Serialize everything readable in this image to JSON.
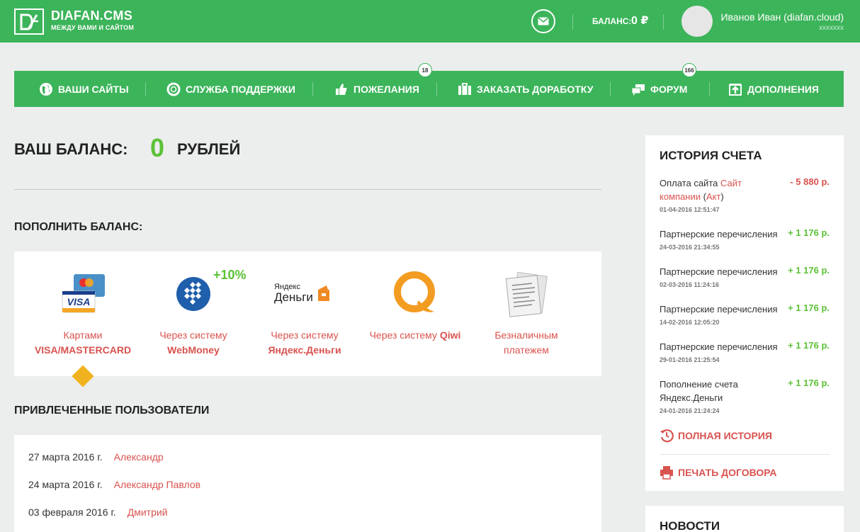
{
  "header": {
    "logo_title": "DIAFAN.CMS",
    "logo_subtitle": "МЕЖДУ ВАМИ И САЙТОМ",
    "balance_label": "БАЛАНС:",
    "balance_value": "0 ₽",
    "user_name": "Иванов Иван (diafan.cloud)",
    "user_login": "xxxxxxx",
    "icons": {
      "logo": "logo-icon",
      "mail": "mail-icon"
    }
  },
  "nav": {
    "items": [
      {
        "label": "ВАШИ САЙТЫ",
        "icon": "globe-icon"
      },
      {
        "label": "СЛУЖБА ПОДДЕРЖКИ",
        "icon": "lifebuoy-icon"
      },
      {
        "label": "ПОЖЕЛАНИЯ",
        "icon": "thumbs-up-icon",
        "badge": "18"
      },
      {
        "label": "ЗАКАЗАТЬ ДОРАБОТКУ",
        "icon": "briefcase-icon"
      },
      {
        "label": "ФОРУМ",
        "icon": "chat-icon",
        "badge": "166"
      },
      {
        "label": "ДОПОЛНЕНИЯ",
        "icon": "upload-icon"
      }
    ]
  },
  "balance": {
    "title": "ВАШ БАЛАНС:",
    "amount": "0",
    "unit": "РУБЛЕЙ"
  },
  "topup": {
    "title": "ПОПОЛНИТЬ БАЛАНС:",
    "options": [
      {
        "line1": "Картами",
        "line2": "VISA/MASTERCARD",
        "icon": "credit-card-icon",
        "selected": true
      },
      {
        "line1": "Через систему",
        "line2": "WebMoney",
        "icon": "webmoney-icon",
        "bonus": "+10%"
      },
      {
        "line1": "Через систему",
        "line2": "Яндекс.Деньги",
        "icon": "yandex-money-icon",
        "logo_text1": "Яндекс",
        "logo_text2": "Деньги"
      },
      {
        "line1": "Через систему",
        "line1_bold": "Qiwi",
        "icon": "qiwi-icon"
      },
      {
        "line1": "Безналичным",
        "line2": "платежем",
        "icon": "invoice-icon"
      }
    ]
  },
  "referrals": {
    "title": "ПРИВЛЕЧЕННЫЕ ПОЛЬЗОВАТЕЛИ",
    "rows": [
      {
        "date": "27 марта 2016 г.",
        "name": "Александр"
      },
      {
        "date": "24 марта 2016 г.",
        "name": "Александр Павлов"
      },
      {
        "date": "03 февраля 2016 г.",
        "name": "Дмитрий"
      }
    ]
  },
  "history": {
    "title": "ИСТОРИЯ СЧЕТА",
    "items": [
      {
        "desc_pre": "Оплата сайта ",
        "desc_link": "Сайт компании",
        "desc_mid": " (",
        "desc_link2": "Акт",
        "desc_post": ")",
        "date": "01-04-2016 12:51:47",
        "amount": "- 5 880 р.",
        "sign": "neg"
      },
      {
        "desc": "Партнерские перечисления",
        "date": "24-03-2016 21:34:55",
        "amount": "+ 1 176 р.",
        "sign": "pos"
      },
      {
        "desc": "Партнерские перечисления",
        "date": "02-03-2016 11:24:16",
        "amount": "+ 1 176 р.",
        "sign": "pos"
      },
      {
        "desc": "Партнерские перечисления",
        "date": "14-02-2016 12:05:20",
        "amount": "+ 1 176 р.",
        "sign": "pos"
      },
      {
        "desc": "Партнерские перечисления",
        "date": "29-01-2016 21:25:54",
        "amount": "+ 1 176 р.",
        "sign": "pos"
      },
      {
        "desc": "Пополнение счета Яндекс.Деньги",
        "date": "24-01-2016 21:24:24",
        "amount": "+ 1 176 р.",
        "sign": "pos"
      }
    ],
    "full_history": "ПОЛНАЯ ИСТОРИЯ",
    "print_contract": "ПЕЧАТЬ ДОГОВОРА"
  },
  "news": {
    "title": "НОВОСТИ"
  },
  "colors": {
    "brand_green": "#3cb45a",
    "accent_red": "#d9534f",
    "positive_green": "#5bc236",
    "selected_marker": "#f0b31f"
  }
}
